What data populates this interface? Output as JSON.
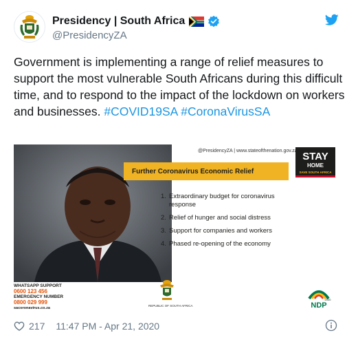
{
  "account": {
    "display_name": "Presidency | South Africa",
    "handle": "@PresidencyZA",
    "verified": true,
    "avatar_icon": "coat-of-arms-icon",
    "flag_icon": "south-africa-flag-icon"
  },
  "tweet": {
    "text_parts": [
      "Government is implementing a range of relief measures to support the most vulnerable South Africans during this difficult time, and to respond to the impact of the lockdown on workers and businesses. ",
      "#COVID19SA",
      " ",
      "#CoronaVirusSA"
    ]
  },
  "media": {
    "credit": "@PresidencyZA | www.stateofthenation.gov.za",
    "banner_title": "Further Coronavirus Economic Relief",
    "stay_home": {
      "line1": "STAY",
      "line2": "HOME",
      "line3": "SAVE SOUTH AFRICA"
    },
    "measures": [
      {
        "num": "1.",
        "text": "Extraordinary budget for coronavirus response"
      },
      {
        "num": "2.",
        "text": "Relief of hunger and social distress"
      },
      {
        "num": "3.",
        "text": "Support for companies and workers"
      },
      {
        "num": "4.",
        "text": "Phased re-opening of the economy"
      }
    ],
    "support": {
      "whatsapp_label": "WHATSAPP SUPPORT",
      "whatsapp_number": "0600 123 456",
      "emergency_label": "EMERGENCY NUMBER",
      "emergency_number": "0800 029 999",
      "website": "sacoronavirus.co.za"
    },
    "coat_label": "REPUBLIC OF SOUTH AFRICA",
    "ndp_label": "NDP",
    "ndp_year": "2030"
  },
  "footer": {
    "likes": "217",
    "timestamp": "11:47 PM - Apr 21, 2020"
  },
  "colors": {
    "hashtag": "#1b95e0",
    "verified": "#1da1f2",
    "banner": "#f0b323"
  }
}
